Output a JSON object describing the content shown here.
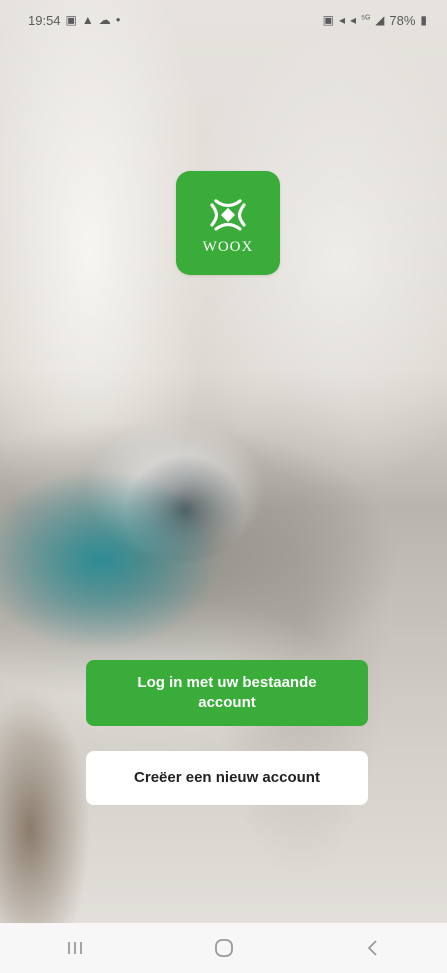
{
  "status_bar": {
    "time": "19:54",
    "battery_percent": "78%",
    "left_icons": [
      "calendar-icon",
      "warning-icon",
      "cloud-icon",
      "dot-icon"
    ],
    "right_icons": [
      "nfc-icon",
      "mute-icon",
      "sound-icon",
      "volte-icon",
      "signal-icon",
      "battery-icon"
    ]
  },
  "logo": {
    "text": "WOOX",
    "color": "#3aac3a"
  },
  "buttons": {
    "login_label": "Log in met uw bestaande account",
    "create_label": "Creëer een nieuw account"
  },
  "colors": {
    "primary": "#3aac3a",
    "secondary_button_bg": "#ffffff"
  },
  "nav_bar": {
    "items": [
      "recent-apps-icon",
      "home-icon",
      "back-icon"
    ]
  }
}
